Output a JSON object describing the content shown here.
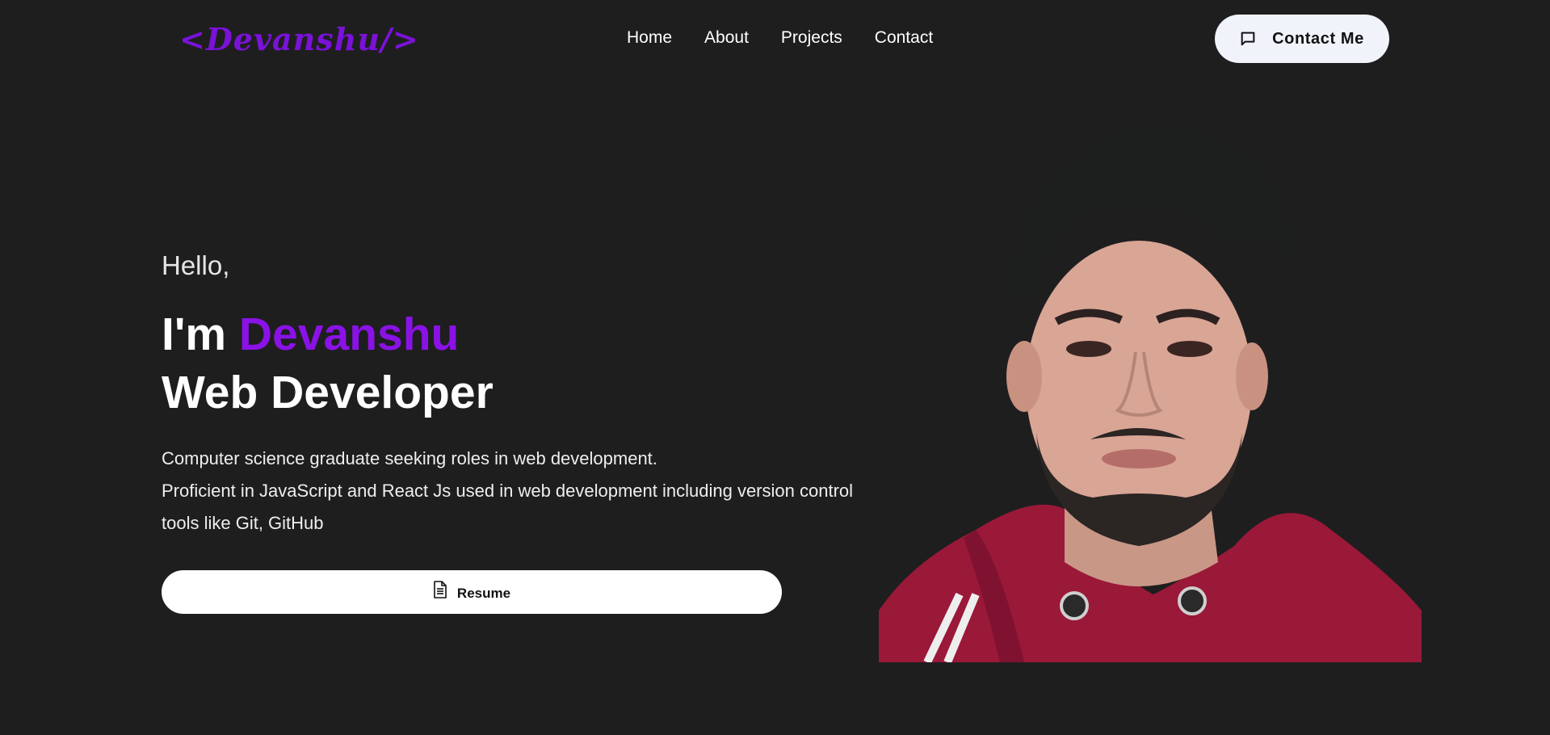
{
  "navbar": {
    "logo": "<Devanshu/>",
    "links": [
      "Home",
      "About",
      "Projects",
      "Contact"
    ],
    "contact_button": "Contact Me"
  },
  "hero": {
    "greeting": "Hello,",
    "intro_prefix": "I'm ",
    "name": "Devanshu",
    "role": "Web Developer",
    "description_line1": "Computer science graduate seeking roles in web development.",
    "description_line2": "Proficient in JavaScript and React Js used in web development including version control tools like Git, GitHub",
    "resume_button": "Resume"
  },
  "icons": {
    "contact": "chat-bubble-icon",
    "resume": "document-icon"
  },
  "colors": {
    "background": "#1e1e1f",
    "accent": "#8a12e6",
    "logo": "#7a12d8",
    "button_bg": "#f0f3fa",
    "hoodie": "#9a1838"
  }
}
